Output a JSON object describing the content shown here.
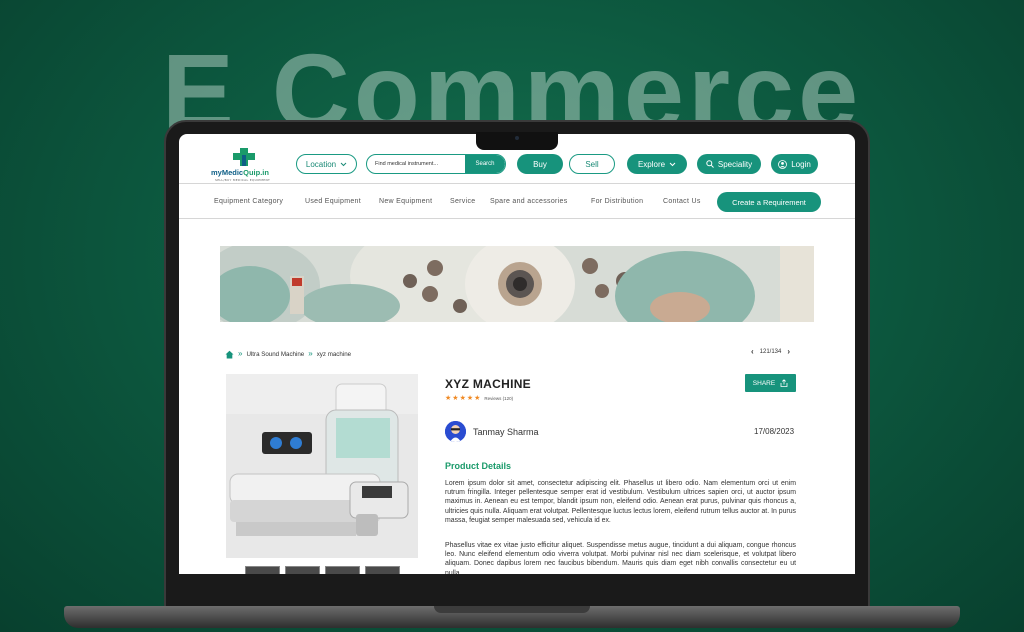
{
  "hero": {
    "title": "E Commerce"
  },
  "logo": {
    "brand_part1": "myMedic",
    "brand_part2": "Quip.in",
    "tagline": "SELL/BUY MEDICAL EQUIPMENT"
  },
  "header": {
    "location_label": "Location",
    "search": {
      "placeholder": "Find medical instrument...",
      "button_label": "Search"
    },
    "buy_label": "Buy",
    "sell_label": "Sell",
    "explore_label": "Explore",
    "speciality_label": "Speciality",
    "login_label": "Login"
  },
  "nav": {
    "items": [
      "Equipment Category",
      "Used Equipment",
      "New Equipment",
      "Service",
      "Spare and accessories",
      "For Distribution",
      "Contact Us"
    ],
    "cta_label": "Create a Requirement"
  },
  "breadcrumb": {
    "items": [
      "Ultra Sound Machine",
      "xyz machine"
    ]
  },
  "pager": {
    "text": "121/134"
  },
  "product": {
    "title": "XYZ MACHINE",
    "rating": 5,
    "reviews_text": "Reviews (120)",
    "share_label": "SHARE",
    "author": "Tanmay Sharma",
    "date": "17/08/2023",
    "section_title": "Product Details",
    "description_1": "Lorem ipsum dolor sit amet, consectetur adipiscing elit. Phasellus ut libero odio. Nam elementum orci ut enim rutrum fringilla. Integer pellentesque semper erat id vestibulum. Vestibulum ultrices sapien orci, ut auctor ipsum maximus in. Aenean eu est tempor, blandit ipsum non, eleifend odio. Aenean erat purus, pulvinar quis rhoncus a, ultricies quis nulla. Aliquam erat volutpat. Pellentesque luctus lectus lorem, eleifend rutrum tellus auctor at. In purus massa, feugiat semper malesuada sed, vehicula id ex.",
    "description_2": "Phasellus vitae ex vitae justo efficitur aliquet. Suspendisse metus augue, tincidunt a dui aliquam, congue rhoncus leo. Nunc eleifend elementum odio viverra volutpat. Morbi pulvinar nisl nec diam scelerisque, et volutpat libero aliquam. Donec dapibus lorem nec faucibus bibendum. Mauris quis diam eget nibh convallis consectetur eu ut nulla."
  },
  "colors": {
    "brand_green": "#17937c",
    "star": "#f08a24",
    "background": "#0d5a40"
  }
}
